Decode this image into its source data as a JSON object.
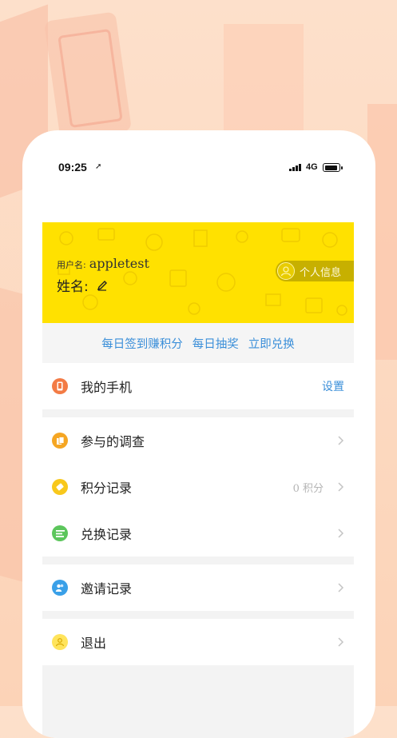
{
  "status_bar": {
    "time": "09:25",
    "network": "4G"
  },
  "profile_card": {
    "username_label": "用户名:",
    "username_value": "appletest",
    "name_label": "姓名:",
    "profile_button": "个人信息",
    "banner_color": "#ffe100"
  },
  "quick_links": [
    "每日签到赚积分",
    "每日抽奖",
    "立即兑换"
  ],
  "menu": {
    "my_phone": {
      "label": "我的手机",
      "action": "设置",
      "icon": "phone-icon",
      "color": "#f37b45"
    },
    "surveys": {
      "label": "参与的调查",
      "icon": "document-icon",
      "color": "#f5a623"
    },
    "points": {
      "label": "积分记录",
      "meta": "0 积分",
      "icon": "ticket-icon",
      "color": "#f8c81c"
    },
    "exchange": {
      "label": "兑换记录",
      "icon": "list-icon",
      "color": "#5cc65c"
    },
    "invite": {
      "label": "邀请记录",
      "icon": "people-icon",
      "color": "#3aa0e8"
    },
    "logout": {
      "label": "退出",
      "icon": "user-icon",
      "color": "#ffe45c"
    }
  },
  "accent_link_color": "#3b8fd9"
}
